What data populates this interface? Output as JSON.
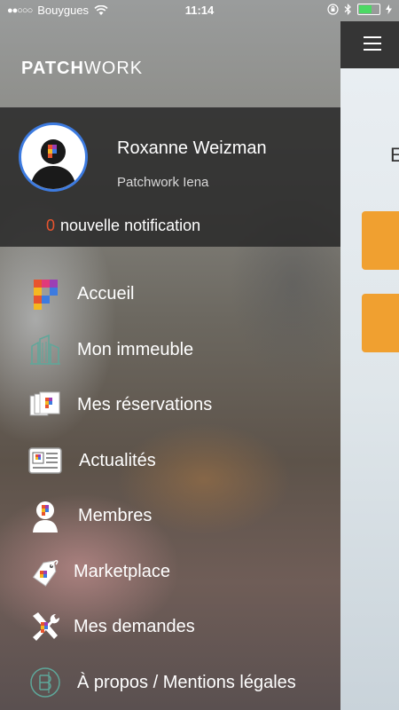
{
  "status_bar": {
    "signal_dots": "●●○○○",
    "carrier": "Bouygues",
    "time": "11:14",
    "battery_level": 0.6,
    "wifi_icon": "wifi-icon",
    "bluetooth_icon": "bluetooth-icon",
    "lock_icon": "orientation-lock-icon"
  },
  "brand": {
    "bold": "PATCH",
    "light": "WORK"
  },
  "profile": {
    "name": "Roxanne Weizman",
    "company": "Patchwork Iena",
    "notification_count": "0",
    "notification_text": "nouvelle notification"
  },
  "menu": {
    "items": [
      {
        "label": "Accueil",
        "icon": "patchwork-logo-icon"
      },
      {
        "label": "Mon immeuble",
        "icon": "building-icon"
      },
      {
        "label": "Mes réservations",
        "icon": "reservations-icon"
      },
      {
        "label": "Actualités",
        "icon": "newspaper-icon"
      },
      {
        "label": "Membres",
        "icon": "member-icon"
      },
      {
        "label": "Marketplace",
        "icon": "tag-icon"
      },
      {
        "label": "Mes demandes",
        "icon": "tools-icon"
      },
      {
        "label": "À propos / Mentions légales",
        "icon": "info-icon"
      }
    ]
  },
  "right_panel": {
    "partial_text": "E"
  },
  "colors": {
    "accent_blue": "#3d7be0",
    "notification_red": "#e8542e",
    "button_orange": "#f0a030"
  }
}
